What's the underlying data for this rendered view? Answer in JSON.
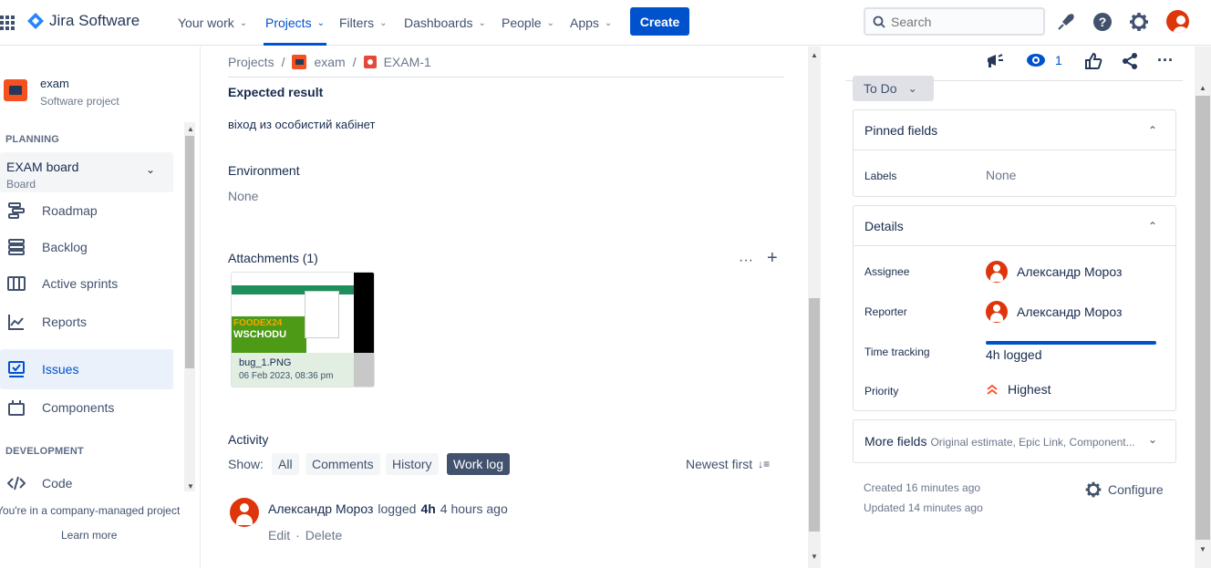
{
  "app": {
    "name": "Jira Software"
  },
  "nav": {
    "your_work": "Your work",
    "projects": "Projects",
    "filters": "Filters",
    "dashboards": "Dashboards",
    "people": "People",
    "apps": "Apps",
    "create": "Create",
    "search_placeholder": "Search"
  },
  "sidebar": {
    "project_name": "exam",
    "project_type": "Software project",
    "planning_title": "PLANNING",
    "board_name": "EXAM board",
    "board_sub": "Board",
    "items": [
      {
        "label": "Roadmap",
        "icon": "roadmap-icon"
      },
      {
        "label": "Backlog",
        "icon": "backlog-icon"
      },
      {
        "label": "Active sprints",
        "icon": "sprints-icon"
      },
      {
        "label": "Reports",
        "icon": "reports-icon"
      },
      {
        "label": "Issues",
        "icon": "issues-icon"
      },
      {
        "label": "Components",
        "icon": "components-icon"
      }
    ],
    "development_title": "DEVELOPMENT",
    "code": "Code",
    "company_note": "You're in a company-managed project",
    "learn_more": "Learn more"
  },
  "breadcrumb": {
    "projects": "Projects",
    "project": "exam",
    "issue": "EXAM-1"
  },
  "issue": {
    "expected_title": "Expected result",
    "expected_text": "вiхoд из особистий кабiнет",
    "environment_title": "Environment",
    "environment_value": "None",
    "attachments_title": "Attachments (1)",
    "attachment": {
      "name": "bug_1.PNG",
      "date": "06 Feb 2023, 08:36 pm",
      "preview_brand": "FOODEX24",
      "preview_text": "WSCHODU"
    }
  },
  "activity": {
    "title": "Activity",
    "show_label": "Show:",
    "filters": [
      "All",
      "Comments",
      "History",
      "Work log"
    ],
    "active_filter": "Work log",
    "sort": "Newest first",
    "entry": {
      "user": "Александр Мороз",
      "action": "logged",
      "amount": "4h",
      "time": "4 hours ago",
      "edit": "Edit",
      "delete": "Delete",
      "separator": "·"
    }
  },
  "right": {
    "watchers": "1",
    "status": "To Do",
    "pinned_title": "Pinned fields",
    "labels_label": "Labels",
    "labels_value": "None",
    "details_title": "Details",
    "assignee_label": "Assignee",
    "assignee": "Александр Мороз",
    "reporter_label": "Reporter",
    "reporter": "Александр Мороз",
    "time_label": "Time tracking",
    "time_value": "4h logged",
    "time_progress": 1.0,
    "priority_label": "Priority",
    "priority": "Highest",
    "more_title": "More fields",
    "more_sub": "Original estimate, Epic Link, Component...",
    "created": "Created 16 minutes ago",
    "updated": "Updated 14 minutes ago",
    "configure": "Configure"
  },
  "colors": {
    "primary": "#0052cc",
    "avatar": "#de350b",
    "priority": "#ff5630"
  }
}
